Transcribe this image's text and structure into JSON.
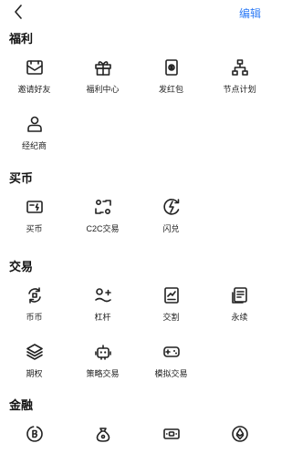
{
  "header": {
    "edit_label": "编辑"
  },
  "sections": [
    {
      "title": "福利",
      "items": [
        {
          "label": "邀请好友",
          "icon": "envelope-icon"
        },
        {
          "label": "福利中心",
          "icon": "gift-icon"
        },
        {
          "label": "发红包",
          "icon": "red-packet-icon"
        },
        {
          "label": "节点计划",
          "icon": "node-tree-icon"
        },
        {
          "label": "经纪商",
          "icon": "person-icon"
        }
      ]
    },
    {
      "title": "买币",
      "items": [
        {
          "label": "买币",
          "icon": "buy-card-icon"
        },
        {
          "label": "C2C交易",
          "icon": "c2c-icon"
        },
        {
          "label": "闪兑",
          "icon": "flash-icon"
        }
      ]
    },
    {
      "title": "交易",
      "items": [
        {
          "label": "币币",
          "icon": "swap-icon"
        },
        {
          "label": "杠杆",
          "icon": "leverage-icon"
        },
        {
          "label": "交割",
          "icon": "delivery-chart-icon"
        },
        {
          "label": "永续",
          "icon": "perpetual-doc-icon"
        },
        {
          "label": "期权",
          "icon": "layers-icon"
        },
        {
          "label": "策略交易",
          "icon": "robot-icon"
        },
        {
          "label": "模拟交易",
          "icon": "game-controller-icon"
        }
      ]
    },
    {
      "title": "金融",
      "items": [
        {
          "label": "",
          "icon": "bitcoin-coin-icon"
        },
        {
          "label": "",
          "icon": "money-bag-icon"
        },
        {
          "label": "",
          "icon": "cash-icon"
        },
        {
          "label": "",
          "icon": "ethereum-icon"
        }
      ]
    }
  ]
}
